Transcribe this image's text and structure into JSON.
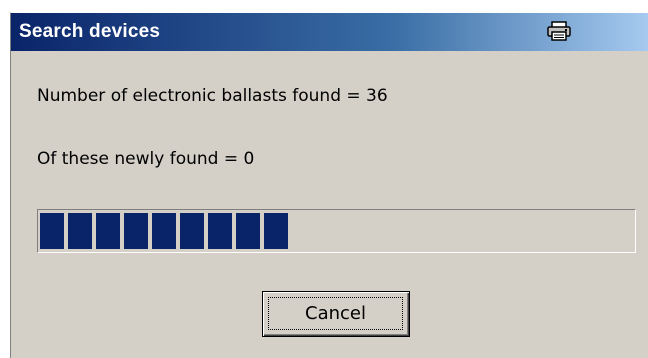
{
  "window": {
    "title": "Search devices",
    "title_icon": "print-icon"
  },
  "content": {
    "found_text": "Number of electronic ballasts found = 36",
    "new_text": "Of these newly found  = 0"
  },
  "progress": {
    "fraction": 0.43
  },
  "buttons": {
    "cancel_label": "Cancel"
  },
  "colors": {
    "title_start": "#0a246a",
    "title_end": "#a6caf0",
    "progress_block": "#0a246a",
    "window_bg": "#d4d0c8"
  }
}
